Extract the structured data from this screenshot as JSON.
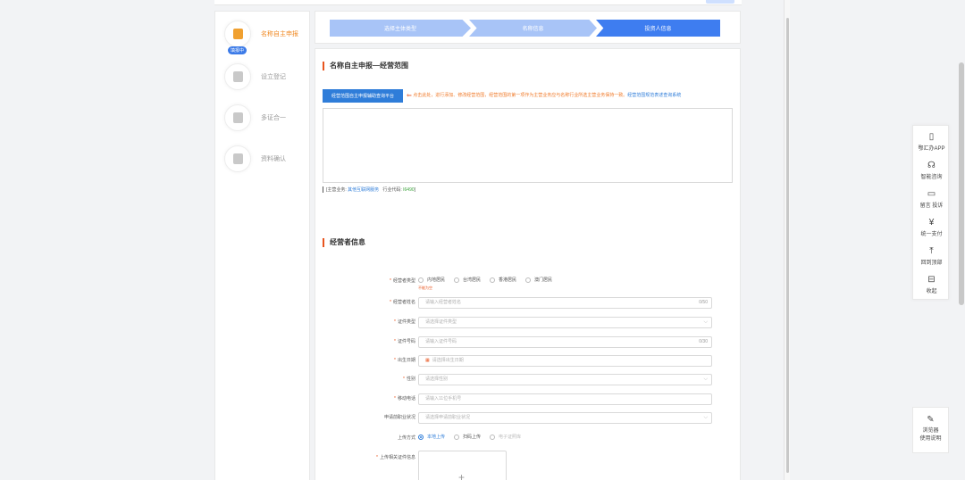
{
  "steps": [
    {
      "label": "名称自主申报",
      "badge": "填报中",
      "icon": "document-icon",
      "active": true
    },
    {
      "label": "设立登记",
      "icon": "edit-icon"
    },
    {
      "label": "多证合一",
      "icon": "stamp-icon"
    },
    {
      "label": "资料确认",
      "icon": "file-icon"
    }
  ],
  "progress": [
    "选择主体类型",
    "名称信息",
    "投资人信息"
  ],
  "scope": {
    "title": "名称自主申报—经营范围",
    "button": "经营范围自主申报辅助查询平台",
    "hint": "点击此处，进行添加、修改经营范围，经营范围的第一项作为主营业务应与名称行业所选主营业务保持一致。",
    "hint_link": "经营范围规范表述查询系统",
    "meta_main_label": "[主营业务:",
    "meta_main_value": "其他互联网服务",
    "meta_code_label": "行业代码:",
    "meta_code_value": "I6490",
    "meta_close": "]"
  },
  "operator": {
    "title": "经营者信息",
    "type_label": "经营者类型",
    "type_options": [
      "内地居民",
      "台湾居民",
      "香港居民",
      "澳门居民"
    ],
    "type_error": "不能为空",
    "name_label": "经营者姓名",
    "name_placeholder": "请输入经营者姓名",
    "name_count": "0/50",
    "id_type_label": "证件类型",
    "id_type_placeholder": "请选择证件类型",
    "id_no_label": "证件号码",
    "id_no_placeholder": "请输入证件号码",
    "id_no_count": "0/30",
    "birth_label": "出生日期",
    "birth_placeholder": "请选择出生日期",
    "gender_label": "性别",
    "gender_placeholder": "请选择性别",
    "phone_label": "移动电话",
    "phone_placeholder": "请输入11位手机号",
    "job_label": "申请前职业状况",
    "job_placeholder": "请选择申请前职业状况",
    "upload_mode_label": "上传方式",
    "upload_modes": [
      "本地上传",
      "扫码上传",
      "电子证照库"
    ],
    "upload_files_label": "上传相关证件信息"
  },
  "sidebar_float": [
    {
      "label": "鄂汇办APP",
      "icon": "phone-icon",
      "glyph": "▯"
    },
    {
      "label": "智能咨询",
      "icon": "headset-icon",
      "glyph": "☊"
    },
    {
      "label": "留言 投诉",
      "icon": "message-icon",
      "glyph": "▭"
    },
    {
      "label": "统一支付",
      "icon": "yuan-icon",
      "glyph": "¥"
    },
    {
      "label": "回到顶部",
      "icon": "to-top-icon",
      "glyph": "⤒"
    },
    {
      "label": "收起",
      "icon": "collapse-icon",
      "glyph": "⊟"
    }
  ],
  "browser_help": {
    "line1": "浏览器",
    "line2": "使用说明",
    "icon": "feather-icon"
  }
}
